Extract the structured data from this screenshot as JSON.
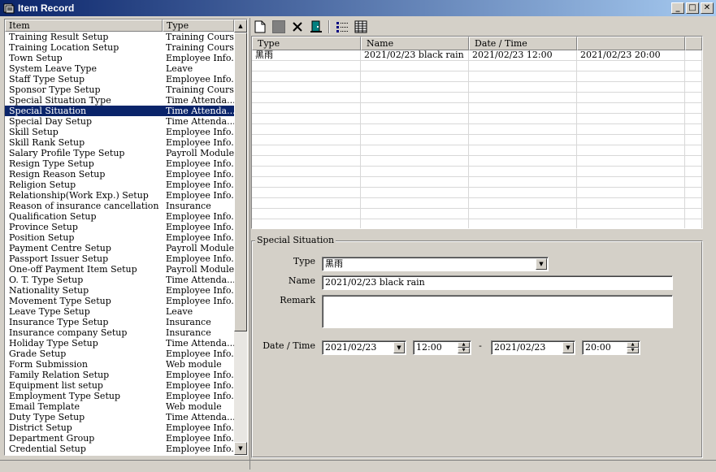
{
  "window": {
    "title": "Item Record",
    "minimize": "_",
    "maximize": "□",
    "close": "✕"
  },
  "item_list": {
    "columns": [
      "Item",
      "Type"
    ],
    "selected_index": 7,
    "rows": [
      {
        "item": "Training Result Setup",
        "type": "Training Course"
      },
      {
        "item": "Training Location Setup",
        "type": "Training Course"
      },
      {
        "item": "Town Setup",
        "type": "Employee Info."
      },
      {
        "item": "System Leave Type",
        "type": "Leave"
      },
      {
        "item": "Staff Type Setup",
        "type": "Employee Info."
      },
      {
        "item": "Sponsor Type Setup",
        "type": "Training Course"
      },
      {
        "item": "Special Situation Type",
        "type": "Time Attenda..."
      },
      {
        "item": "Special Situation",
        "type": "Time Attenda..."
      },
      {
        "item": "Special Day Setup",
        "type": "Time Attenda..."
      },
      {
        "item": "Skill Setup",
        "type": "Employee Info."
      },
      {
        "item": "Skill Rank Setup",
        "type": "Employee Info."
      },
      {
        "item": "Salary Profile Type Setup",
        "type": "Payroll Module"
      },
      {
        "item": "Resign Type Setup",
        "type": "Employee Info."
      },
      {
        "item": "Resign Reason Setup",
        "type": "Employee Info."
      },
      {
        "item": "Religion Setup",
        "type": "Employee Info."
      },
      {
        "item": "Relationship(Work Exp.) Setup",
        "type": "Employee Info."
      },
      {
        "item": "Reason of insurance cancellation Setup",
        "type": "Insurance"
      },
      {
        "item": "Qualification Setup",
        "type": "Employee Info."
      },
      {
        "item": "Province Setup",
        "type": "Employee Info."
      },
      {
        "item": "Position Setup",
        "type": "Employee Info."
      },
      {
        "item": "Payment Centre Setup",
        "type": "Payroll Module"
      },
      {
        "item": "Passport Issuer Setup",
        "type": "Employee Info."
      },
      {
        "item": "One-off Payment Item Setup",
        "type": "Payroll Module"
      },
      {
        "item": "O. T. Type Setup",
        "type": "Time Attenda..."
      },
      {
        "item": "Nationality Setup",
        "type": "Employee Info."
      },
      {
        "item": "Movement Type Setup",
        "type": "Employee Info."
      },
      {
        "item": "Leave Type Setup",
        "type": "Leave"
      },
      {
        "item": "Insurance Type Setup",
        "type": "Insurance"
      },
      {
        "item": "Insurance company Setup",
        "type": "Insurance"
      },
      {
        "item": "Holiday Type Setup",
        "type": "Time Attenda..."
      },
      {
        "item": "Grade Setup",
        "type": "Employee Info."
      },
      {
        "item": "Form Submission",
        "type": "Web module"
      },
      {
        "item": "Family Relation Setup",
        "type": "Employee Info."
      },
      {
        "item": "Equipment list setup",
        "type": "Employee Info."
      },
      {
        "item": "Employment Type Setup",
        "type": "Employee Info."
      },
      {
        "item": "Email Template",
        "type": "Web module"
      },
      {
        "item": "Duty Type Setup",
        "type": "Time Attenda..."
      },
      {
        "item": "District Setup",
        "type": "Employee Info."
      },
      {
        "item": "Department Group",
        "type": "Employee Info."
      },
      {
        "item": "Credential Setup",
        "type": "Employee Info."
      }
    ],
    "scroll_up": "▲",
    "scroll_down": "▼"
  },
  "toolbar": {
    "icons": [
      "new-icon",
      "save-icon",
      "delete-icon",
      "exit-icon",
      "list-view-icon",
      "detail-view-icon"
    ]
  },
  "record_grid": {
    "columns": [
      "Type",
      "Name",
      "Date / Time",
      ""
    ],
    "rows": [
      {
        "type": "黑雨",
        "name": "2021/02/23 black rain",
        "from": "2021/02/23 12:00",
        "to": "2021/02/23 20:00"
      }
    ],
    "empty_rows": 16
  },
  "form": {
    "group_title": "Special Situation",
    "type_label": "Type",
    "type_value": "黑雨",
    "name_label": "Name",
    "name_value": "2021/02/23 black rain",
    "remark_label": "Remark",
    "remark_value": "",
    "datetime_label": "Date / Time",
    "from_date": "2021/02/23",
    "from_time": "12:00",
    "range_sep": "-",
    "to_date": "2021/02/23",
    "to_time": "20:00",
    "dropdown_glyph": "▼",
    "spin_up": "▲",
    "spin_down": "▼"
  }
}
